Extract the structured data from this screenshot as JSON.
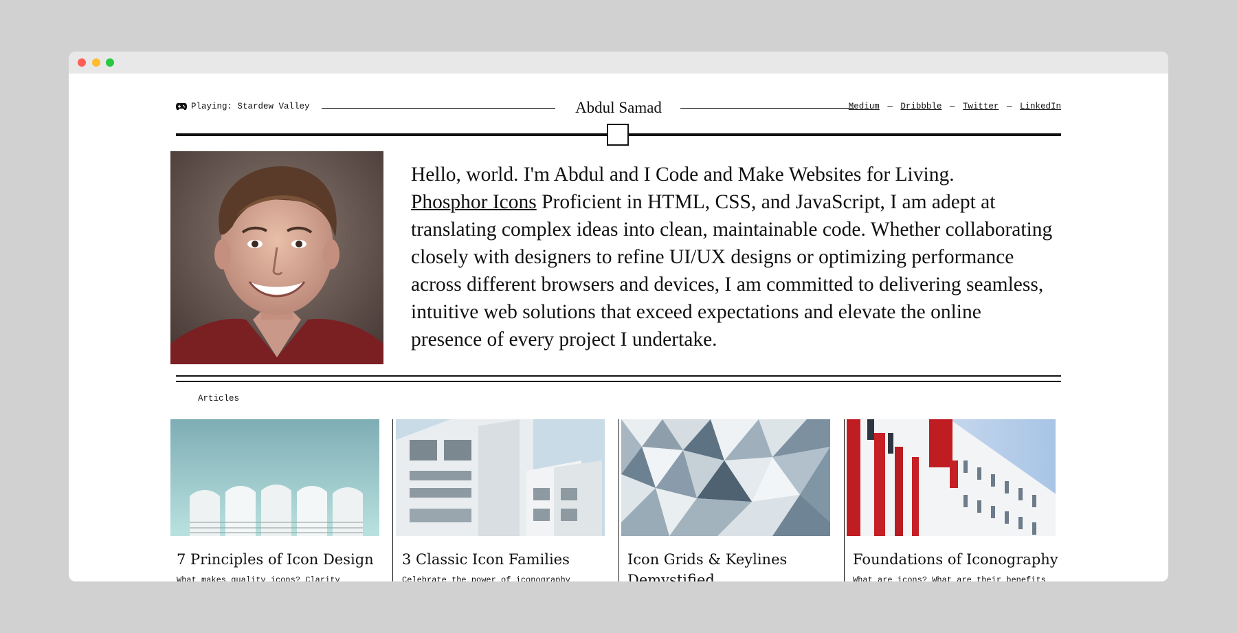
{
  "header": {
    "status_text": "Playing: Stardew Valley",
    "status_icon": "gamepad-icon",
    "site_name": "Abdul Samad",
    "social_links": [
      "Medium",
      "Dribbble",
      "Twitter",
      "LinkedIn"
    ],
    "separator": "—"
  },
  "hero": {
    "intro": "Hello, world. I'm Abdul and I Code and Make Websites for Living.",
    "link_text": "Phosphor Icons",
    "body": " Proficient in HTML, CSS, and JavaScript, I am adept at translating complex ideas into clean, maintainable code. Whether collaborating closely with designers to refine UI/UX designs or optimizing performance across different browsers and devices, I am committed to delivering seamless, intuitive web solutions that exceed expectations and elevate the online presence of every project I undertake."
  },
  "articles": {
    "label": "Articles",
    "items": [
      {
        "title": "7 Principles of Icon Design",
        "excerpt": "What makes quality icons? Clarity"
      },
      {
        "title": "3 Classic Icon Families",
        "excerpt": "Celebrate the power of iconography"
      },
      {
        "title": "Icon Grids & Keylines Demystified",
        "excerpt": ""
      },
      {
        "title": "Foundations of Iconography",
        "excerpt": "What are icons? What are their benefits"
      }
    ]
  },
  "colors": {
    "page_background": "#d1d1d1",
    "window_background": "#ffffff",
    "text": "#111111",
    "close": "#ff5f57",
    "minimize": "#febc2e",
    "maximize": "#28c840"
  }
}
